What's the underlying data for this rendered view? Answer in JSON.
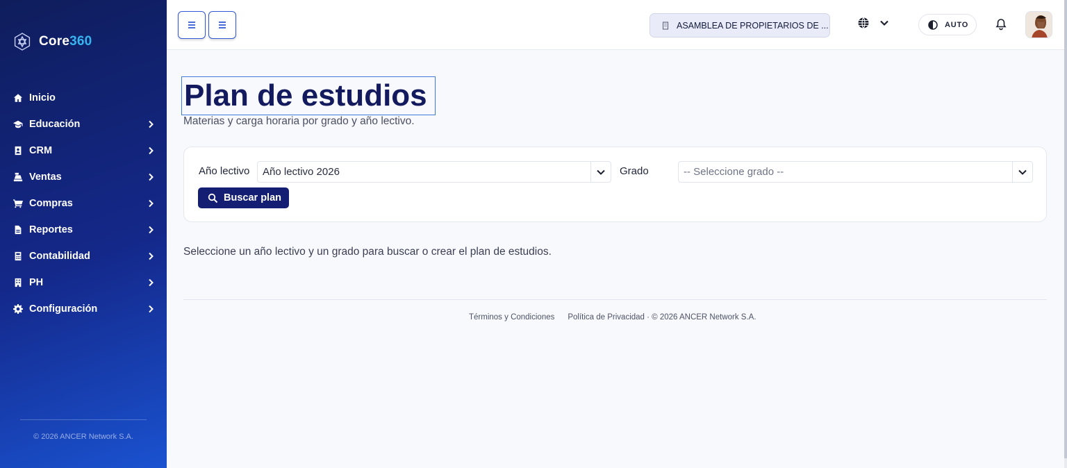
{
  "sidebar": {
    "brand": {
      "name_main": "Core",
      "name_accent": "360"
    },
    "items": [
      {
        "label": "Inicio",
        "icon": "home-icon",
        "expandable": false
      },
      {
        "label": "Educación",
        "icon": "graduation-cap-icon",
        "expandable": true
      },
      {
        "label": "CRM",
        "icon": "contact-card-icon",
        "expandable": true
      },
      {
        "label": "Ventas",
        "icon": "cash-register-icon",
        "expandable": true
      },
      {
        "label": "Compras",
        "icon": "shopping-cart-icon",
        "expandable": true
      },
      {
        "label": "Reportes",
        "icon": "file-report-icon",
        "expandable": true
      },
      {
        "label": "Contabilidad",
        "icon": "calculator-icon",
        "expandable": true
      },
      {
        "label": "PH",
        "icon": "building-icon",
        "expandable": true
      },
      {
        "label": "Configuración",
        "icon": "gear-icon",
        "expandable": true
      }
    ],
    "footer": "© 2026 ANCER Network S.A."
  },
  "topbar": {
    "company": "ASAMBLEA DE PROPIETARIOS DE ...",
    "theme_label": "AUTO"
  },
  "main": {
    "title": "Plan de estudios",
    "subtitle": "Materias y carga horaria por grado y año lectivo.",
    "filters": {
      "year_label": "Año lectivo",
      "year_value": "Año lectivo 2026",
      "grade_label": "Grado",
      "grade_placeholder": "-- Seleccione grado --",
      "search_button": "Buscar plan"
    },
    "info": "Seleccione un año lectivo y un grado para buscar o crear el plan de estudios."
  },
  "footer": {
    "terms": "Términos y Condiciones",
    "privacy": "Política de Privacidad",
    "copyright": " · © 2026 ANCER Network S.A."
  },
  "colors": {
    "accent": "#2f57d6",
    "primary_dark": "#141e72",
    "title": "#131a5e",
    "brand_accent": "#37b4f0"
  }
}
